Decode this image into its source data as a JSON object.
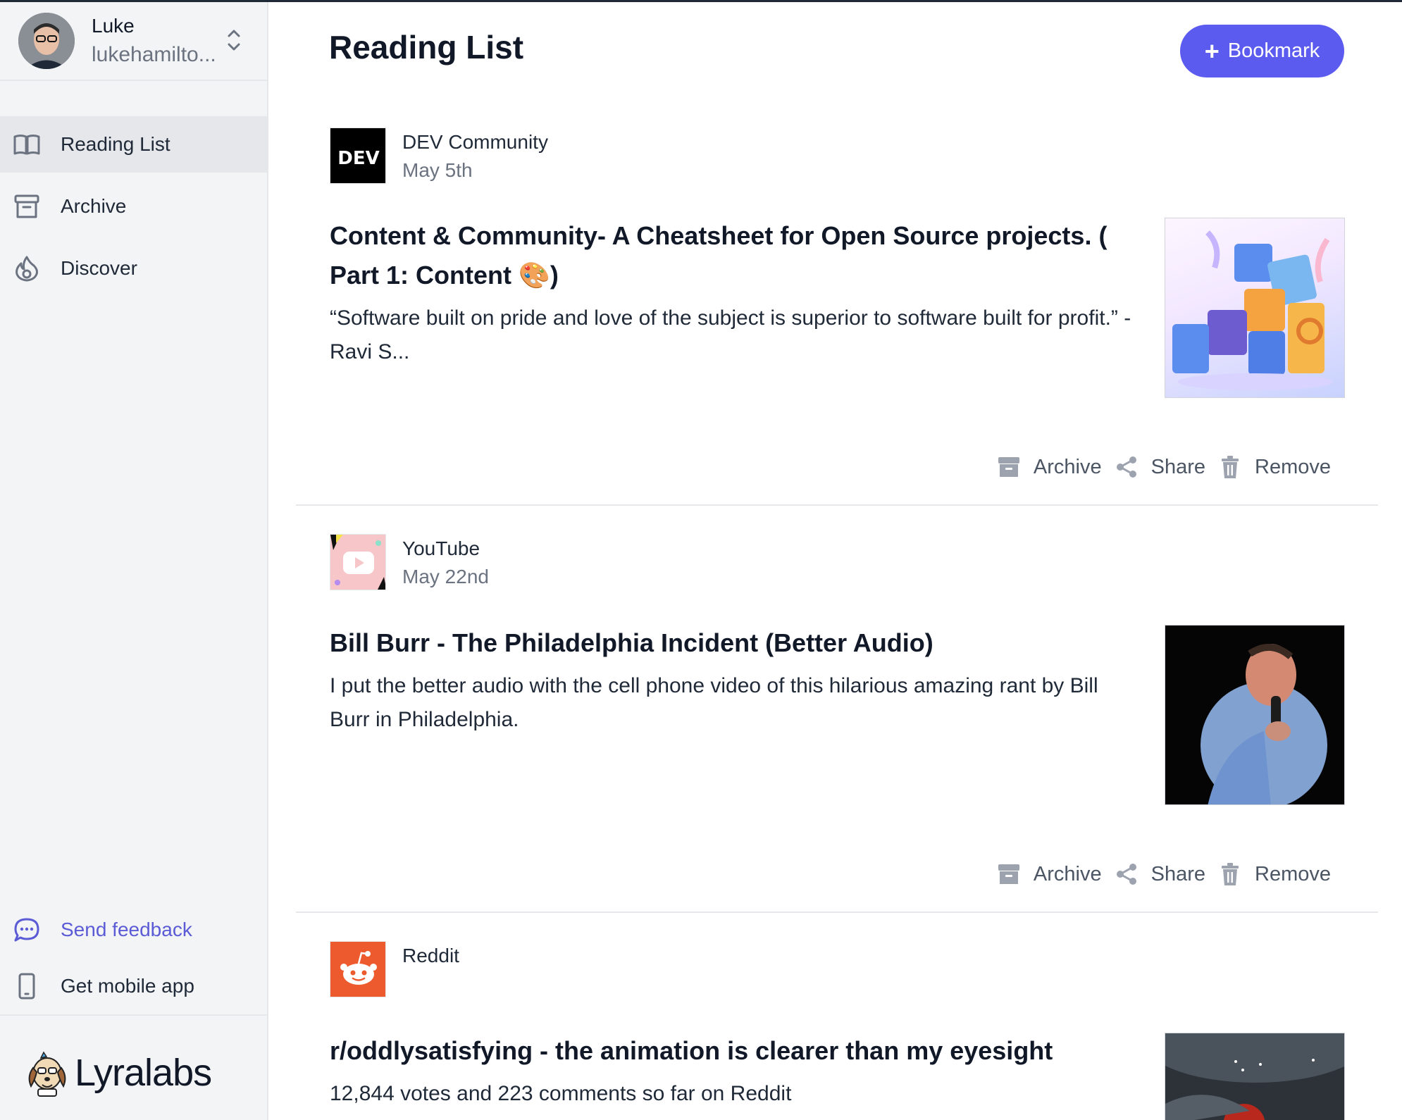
{
  "user": {
    "name": "Luke",
    "email": "lukehamilto..."
  },
  "nav": [
    {
      "label": "Reading List",
      "icon": "book-open-icon",
      "active": true
    },
    {
      "label": "Archive",
      "icon": "archive-icon",
      "active": false
    },
    {
      "label": "Discover",
      "icon": "flame-icon",
      "active": false
    }
  ],
  "bottom": {
    "feedback": "Send feedback",
    "mobile": "Get mobile app"
  },
  "logo": {
    "bold": "Lyra",
    "light": "labs"
  },
  "header": {
    "title": "Reading List",
    "bookmark_label": "Bookmark"
  },
  "actions": {
    "archive": "Archive",
    "share": "Share",
    "remove": "Remove"
  },
  "items": [
    {
      "source": "DEV Community",
      "date": "May 5th",
      "title": "Content & Community- A Cheatsheet for Open Source projects. ( Part 1: Content 🎨)",
      "description": "“Software built on pride and love of the subject is superior to software built for profit.” - Ravi S...",
      "logo_text": "DEV"
    },
    {
      "source": "YouTube",
      "date": "May 22nd",
      "title": "Bill Burr - The Philadelphia Incident (Better Audio)",
      "description": "I put the better audio with the cell phone video of this hilarious amazing rant by Bill Burr in Philadelphia."
    },
    {
      "source": "Reddit",
      "title": "r/oddlysatisfying - the animation is clearer than my eyesight",
      "description": "12,844 votes and 223 comments so far on Reddit"
    }
  ],
  "colors": {
    "accent": "#5b5bf0",
    "feedback": "#5b5bd6",
    "reddit": "#ed5a2e"
  }
}
